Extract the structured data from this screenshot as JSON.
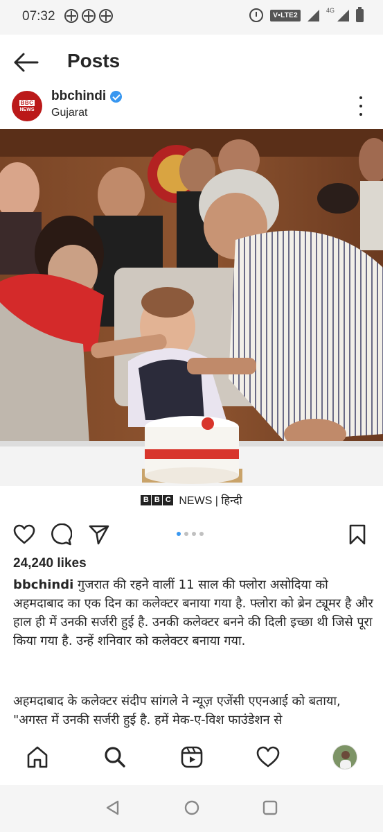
{
  "status_bar": {
    "time": "07:32",
    "volte_label": "V•LTE2",
    "network_label": "4G"
  },
  "top_bar": {
    "title": "Posts"
  },
  "post": {
    "username": "bbchindi",
    "location": "Gujarat",
    "avatar_top": "BBC",
    "avatar_bottom": "NEWS",
    "watermark": {
      "blocks": [
        "B",
        "B",
        "C"
      ],
      "text": "NEWS | हिन्दी"
    },
    "carousel": {
      "total": 4,
      "active_index": 0
    },
    "likes": "24,240 likes",
    "caption_username": "bbchindi",
    "caption_text": "गुजरात की रहने वालीं 11 साल की फ्लोरा असोदिया को अहमदाबाद का एक दिन का कलेक्टर बनाया गया है. फ्लोरा को ब्रेन ट्यूमर है और हाल ही में उनकी सर्जरी हुई है. उनकी कलेक्टर बनने की दिली इच्छा थी जिसे पूरा किया गया है. उन्हें शनिवार को कलेक्टर बनाया गया.",
    "caption_text_2": "अहमदाबाद के कलेक्टर संदीप सांगले ने न्यूज़ एजेंसी एएनआई को बताया, \"अगस्त में उनकी सर्जरी हुई है. हमें मेक-ए-विश फाउंडेशन से"
  },
  "icons": {
    "back": "arrow-left-icon",
    "verified": "verified-badge-icon",
    "more": "more-vertical-icon",
    "like": "heart-icon",
    "comment": "comment-icon",
    "share": "send-icon",
    "save": "bookmark-icon",
    "home": "home-icon",
    "search": "search-icon",
    "reels": "reels-icon",
    "activity": "heart-icon",
    "profile": "profile-avatar"
  },
  "colors": {
    "accent": "#3897f0",
    "bbc_red": "#bb1919",
    "text": "#262626"
  }
}
